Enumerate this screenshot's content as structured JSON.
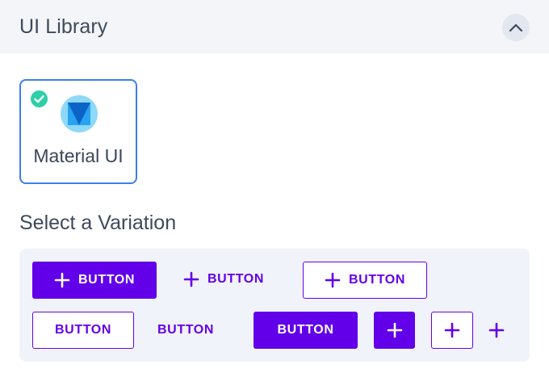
{
  "header": {
    "title": "UI Library",
    "collapse_icon": "chevron-up-icon"
  },
  "library": {
    "name": "Material UI",
    "selected": true,
    "logo_icon": "material-ui-logo",
    "check_icon": "check-circle-icon"
  },
  "section": {
    "title": "Select a Variation"
  },
  "variations": {
    "accent_color": "#6200ea",
    "row1": [
      {
        "style": "contained",
        "label": "BUTTON",
        "icon": "plus-icon"
      },
      {
        "style": "text",
        "label": "BUTTON",
        "icon": "plus-icon"
      },
      {
        "style": "outlined",
        "label": "BUTTON",
        "icon": "plus-icon"
      }
    ],
    "row2": [
      {
        "style": "outlined",
        "label": "BUTTON"
      },
      {
        "style": "text",
        "label": "BUTTON"
      },
      {
        "style": "contained",
        "label": "BUTTON"
      },
      {
        "style": "contained",
        "icon": "plus-icon"
      },
      {
        "style": "outlined",
        "icon": "plus-icon"
      },
      {
        "style": "text",
        "icon": "plus-icon"
      }
    ]
  }
}
